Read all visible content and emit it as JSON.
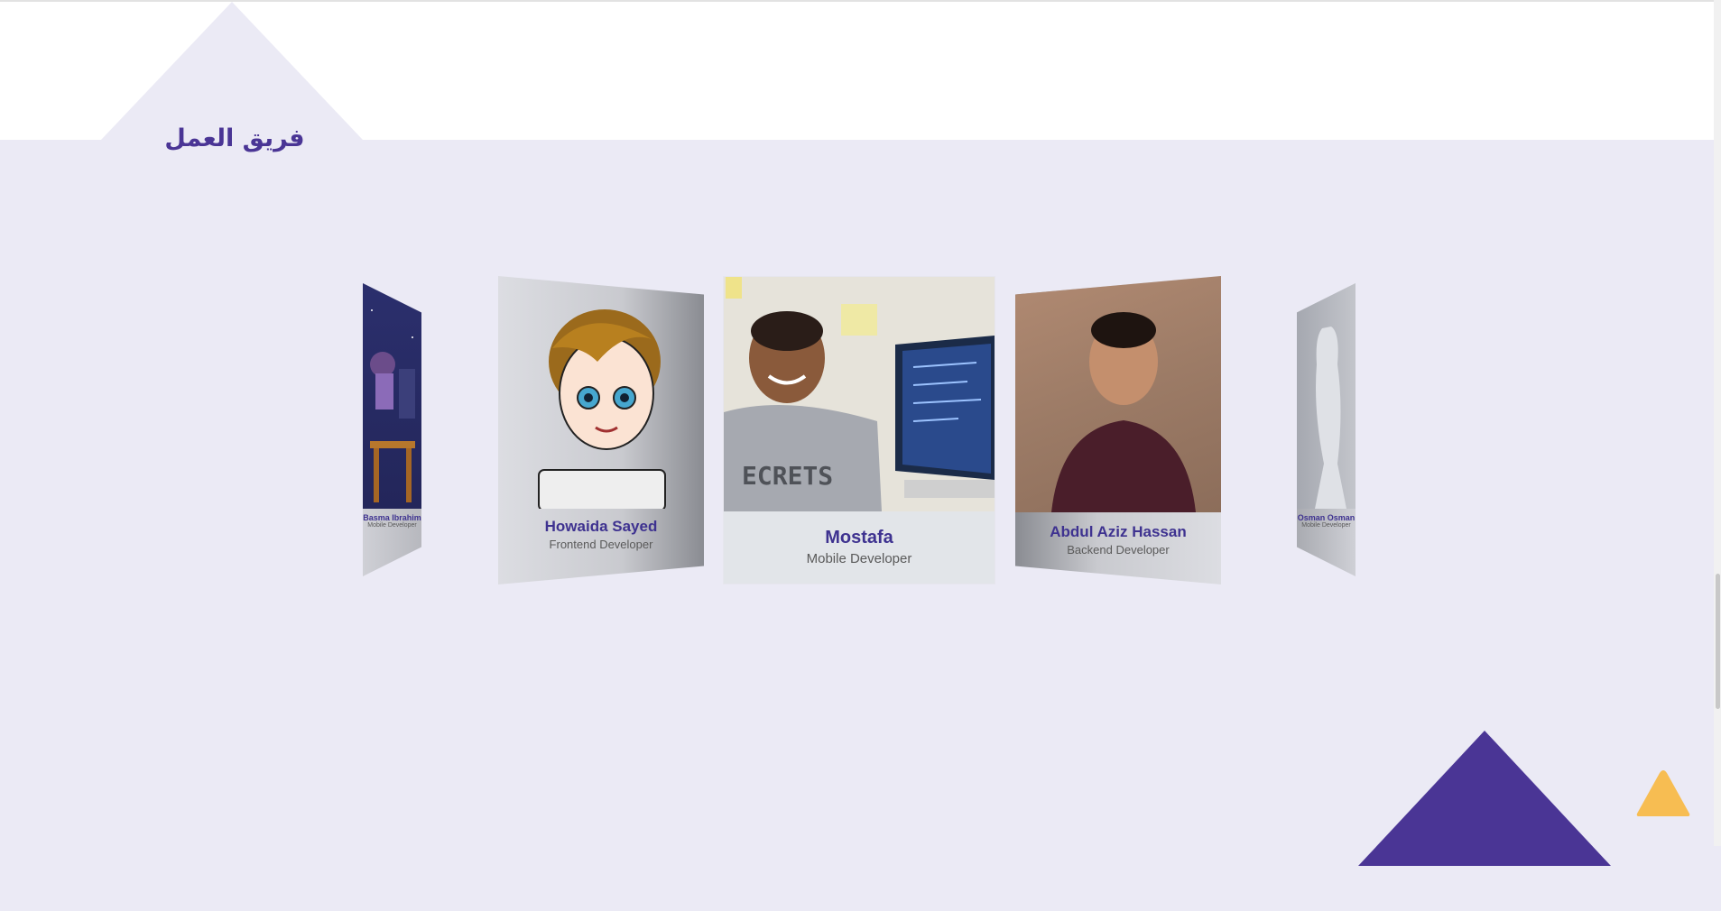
{
  "section": {
    "title": "فريق العمل"
  },
  "team": {
    "far_left": {
      "name": "Basma Ibrahim",
      "role": "Mobile Developer"
    },
    "left": {
      "name": "Howaida Sayed",
      "role": "Frontend Developer"
    },
    "center": {
      "name": "Mostafa",
      "role": "Mobile Developer"
    },
    "right": {
      "name": "Abdul Aziz Hassan",
      "role": "Backend Developer"
    },
    "far_right": {
      "name": "Osman Osman",
      "role": "Mobile Developer"
    }
  },
  "colors": {
    "accent": "#4a3595",
    "background": "#ebeaf5",
    "scroll_top": "#f7bd52"
  },
  "icons": {
    "scroll_top": "triangle-up-icon"
  }
}
